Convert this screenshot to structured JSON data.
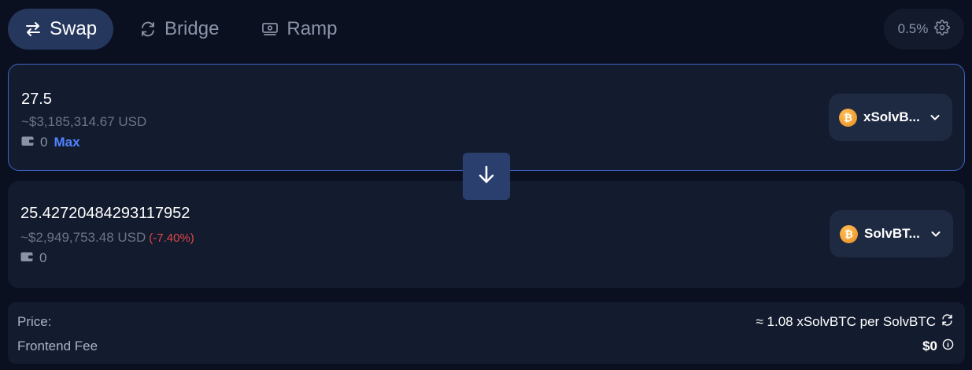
{
  "tabs": [
    {
      "label": "Swap",
      "icon": "swap-arrows-icon",
      "active": true
    },
    {
      "label": "Bridge",
      "icon": "bridge-cycle-icon",
      "active": false
    },
    {
      "label": "Ramp",
      "icon": "cash-icon",
      "active": false
    }
  ],
  "slippage": {
    "value": "0.5%",
    "icon": "gear-icon"
  },
  "from": {
    "amount": "27.5",
    "usd": "~$3,185,314.67 USD",
    "balance": "0",
    "max_label": "Max",
    "token": "xSolvB...",
    "token_icon": "bitcoin-coin-icon"
  },
  "to": {
    "amount": "25.42720484293117952",
    "usd": "~$2,949,753.48 USD",
    "price_impact": "(-7.40%)",
    "balance": "0",
    "token": "SolvBT...",
    "token_icon": "bitcoin-coin-icon"
  },
  "info": {
    "price_label": "Price:",
    "price_value": "≈ 1.08 xSolvBTC per SolvBTC",
    "fee_label": "Frontend Fee",
    "fee_value": "$0"
  },
  "colors": {
    "background": "#0b1020",
    "panel": "#131b2e",
    "active_tab": "#26375e",
    "accent": "#4f83ff",
    "negative": "#e04848",
    "coin": "#f2a03a"
  }
}
